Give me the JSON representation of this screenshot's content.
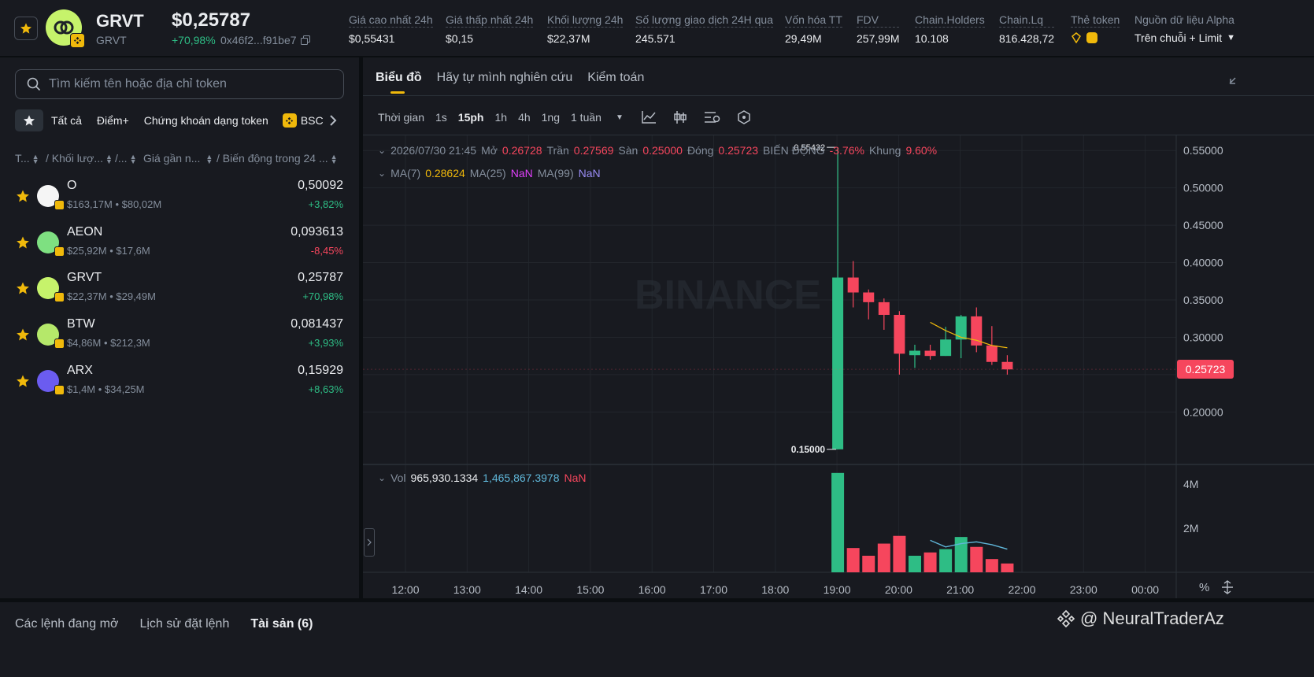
{
  "header": {
    "symbol": "GRVT",
    "name": "GRVT",
    "price": "$0,25787",
    "change": "+70,98%",
    "address": "0x46f2...f91be7",
    "stats": [
      {
        "label": "Giá cao nhất 24h",
        "value": "$0,55431"
      },
      {
        "label": "Giá thấp nhất 24h",
        "value": "$0,15"
      },
      {
        "label": "Khối lượng 24h",
        "value": "$22,37M"
      },
      {
        "label": "Số lượng giao dịch 24H qua",
        "value": "245.571"
      },
      {
        "label": "Vốn hóa TT",
        "value": "29,49M"
      },
      {
        "label": "FDV",
        "value": "257,99M"
      },
      {
        "label": "Chain.Holders",
        "value": "10.108"
      },
      {
        "label": "Chain.Lq",
        "value": "816.428,72"
      },
      {
        "label": "Thẻ token",
        "value": ""
      },
      {
        "label": "Nguồn dữ liệu Alpha",
        "value": "Trên chuỗi + Limit"
      }
    ]
  },
  "sidebar": {
    "search_placeholder": "Tìm kiếm tên hoặc địa chỉ token",
    "filters": [
      "Tất cả",
      "Điểm+",
      "Chứng khoán dạng token"
    ],
    "chain": "BSC",
    "columns": [
      "T...",
      "/ Khối lượ...",
      "/...",
      "Giá gần n...",
      "/ Biến động trong 24 ..."
    ],
    "tokens": [
      {
        "symbol": "O",
        "vol": "$163,17M",
        "mcap": "$80,02M",
        "price": "0,50092",
        "change": "+3,82%",
        "up": true,
        "color": "#f5f5f5"
      },
      {
        "symbol": "AEON",
        "vol": "$25,92M",
        "mcap": "$17,6M",
        "price": "0,093613",
        "change": "-8,45%",
        "up": false,
        "color": "#7ee081"
      },
      {
        "symbol": "GRVT",
        "vol": "$22,37M",
        "mcap": "$29,49M",
        "price": "0,25787",
        "change": "+70,98%",
        "up": true,
        "color": "#c6f36b"
      },
      {
        "symbol": "BTW",
        "vol": "$4,86M",
        "mcap": "$212,3M",
        "price": "0,081437",
        "change": "+3,93%",
        "up": true,
        "color": "#b5e86a"
      },
      {
        "symbol": "ARX",
        "vol": "$1,4M",
        "mcap": "$34,25M",
        "price": "0,15929",
        "change": "+8,63%",
        "up": true,
        "color": "#6b5cf0"
      }
    ]
  },
  "chart_panel": {
    "tabs": [
      "Biểu đồ",
      "Hãy tự mình nghiên cứu",
      "Kiểm toán"
    ],
    "timeframe_label": "Thời gian",
    "timeframes": [
      "1s",
      "15ph",
      "1h",
      "4h",
      "1ng",
      "1 tuần"
    ],
    "active_timeframe": "15ph",
    "ohlc": {
      "date": "2026/07/30 21:45",
      "open_label": "Mở",
      "open": "0.26728",
      "high_label": "Trần",
      "high": "0.27569",
      "low_label": "Sàn",
      "low": "0.25000",
      "close_label": "Đóng",
      "close": "0.25723",
      "change_label": "BIẾN ĐỘNG",
      "change": "-3.76%",
      "range_label": "Khung",
      "range": "9.60%"
    },
    "ma": {
      "ma7_label": "MA(7)",
      "ma7": "0.28624",
      "ma25_label": "MA(25)",
      "ma25": "NaN",
      "ma99_label": "MA(99)",
      "ma99": "NaN"
    },
    "vol_legend": {
      "label": "Vol",
      "v1": "965,930.1334",
      "v2": "1,465,867.3978",
      "v3": "NaN"
    },
    "watermark": "BINANCE",
    "percent_label": "%"
  },
  "chart_data": {
    "type": "candlestick",
    "interval": "15m",
    "price_axis": {
      "ticks": [
        "0.55000",
        "0.50000",
        "0.45000",
        "0.40000",
        "0.35000",
        "0.30000",
        "0.25000",
        "0.20000"
      ],
      "min": 0.135,
      "max": 0.565
    },
    "time_axis": {
      "ticks": [
        "12:00",
        "13:00",
        "14:00",
        "15:00",
        "16:00",
        "17:00",
        "18:00",
        "19:00",
        "20:00",
        "21:00",
        "22:00",
        "23:00",
        "00:00"
      ]
    },
    "high_marker": "0.55432",
    "low_marker": "0.15000",
    "last_price": "0.25723",
    "candles": [
      {
        "t": "19:00",
        "o": 0.15,
        "h": 0.554,
        "l": 0.15,
        "c": 0.38
      },
      {
        "t": "19:15",
        "o": 0.38,
        "h": 0.402,
        "l": 0.34,
        "c": 0.36
      },
      {
        "t": "19:30",
        "o": 0.36,
        "h": 0.364,
        "l": 0.324,
        "c": 0.347
      },
      {
        "t": "19:45",
        "o": 0.347,
        "h": 0.352,
        "l": 0.31,
        "c": 0.33
      },
      {
        "t": "20:00",
        "o": 0.33,
        "h": 0.335,
        "l": 0.25,
        "c": 0.278
      },
      {
        "t": "20:15",
        "o": 0.276,
        "h": 0.29,
        "l": 0.259,
        "c": 0.282
      },
      {
        "t": "20:30",
        "o": 0.282,
        "h": 0.29,
        "l": 0.27,
        "c": 0.275
      },
      {
        "t": "20:45",
        "o": 0.275,
        "h": 0.314,
        "l": 0.275,
        "c": 0.297
      },
      {
        "t": "21:00",
        "o": 0.297,
        "h": 0.33,
        "l": 0.272,
        "c": 0.328
      },
      {
        "t": "21:15",
        "o": 0.328,
        "h": 0.34,
        "l": 0.28,
        "c": 0.289
      },
      {
        "t": "21:30",
        "o": 0.289,
        "h": 0.315,
        "l": 0.263,
        "c": 0.267
      },
      {
        "t": "21:45",
        "o": 0.267,
        "h": 0.276,
        "l": 0.25,
        "c": 0.257
      }
    ],
    "ma7": [
      null,
      null,
      null,
      null,
      null,
      null,
      0.32,
      0.309,
      0.3,
      0.296,
      0.289,
      0.286
    ],
    "volume_axis": {
      "ticks": [
        "4M",
        "2M"
      ],
      "max": 4.6
    },
    "volume_unit": "M",
    "volume": [
      4.5,
      1.1,
      0.75,
      1.3,
      1.65,
      0.75,
      0.9,
      1.05,
      1.6,
      1.15,
      0.6,
      0.4
    ],
    "volume_ma": [
      null,
      null,
      null,
      null,
      null,
      null,
      1.45,
      1.15,
      1.3,
      1.38,
      1.25,
      1.05
    ],
    "colors": {
      "up": "#2ebd85",
      "down": "#f6465d",
      "ma7": "#f0b90b",
      "vol_ma": "#5fb6d8"
    }
  },
  "bottom": {
    "tabs": [
      "Các lệnh đang mở",
      "Lịch sử đặt lệnh",
      "Tài sản (6)"
    ],
    "active": 2
  },
  "overlay": {
    "watermark": "@ NeuralTraderAz"
  },
  "colors": {
    "up": "#2ebd85",
    "down": "#f6465d",
    "accent": "#f0b90b",
    "bg": "#0b0e11",
    "panel": "#181a20"
  }
}
